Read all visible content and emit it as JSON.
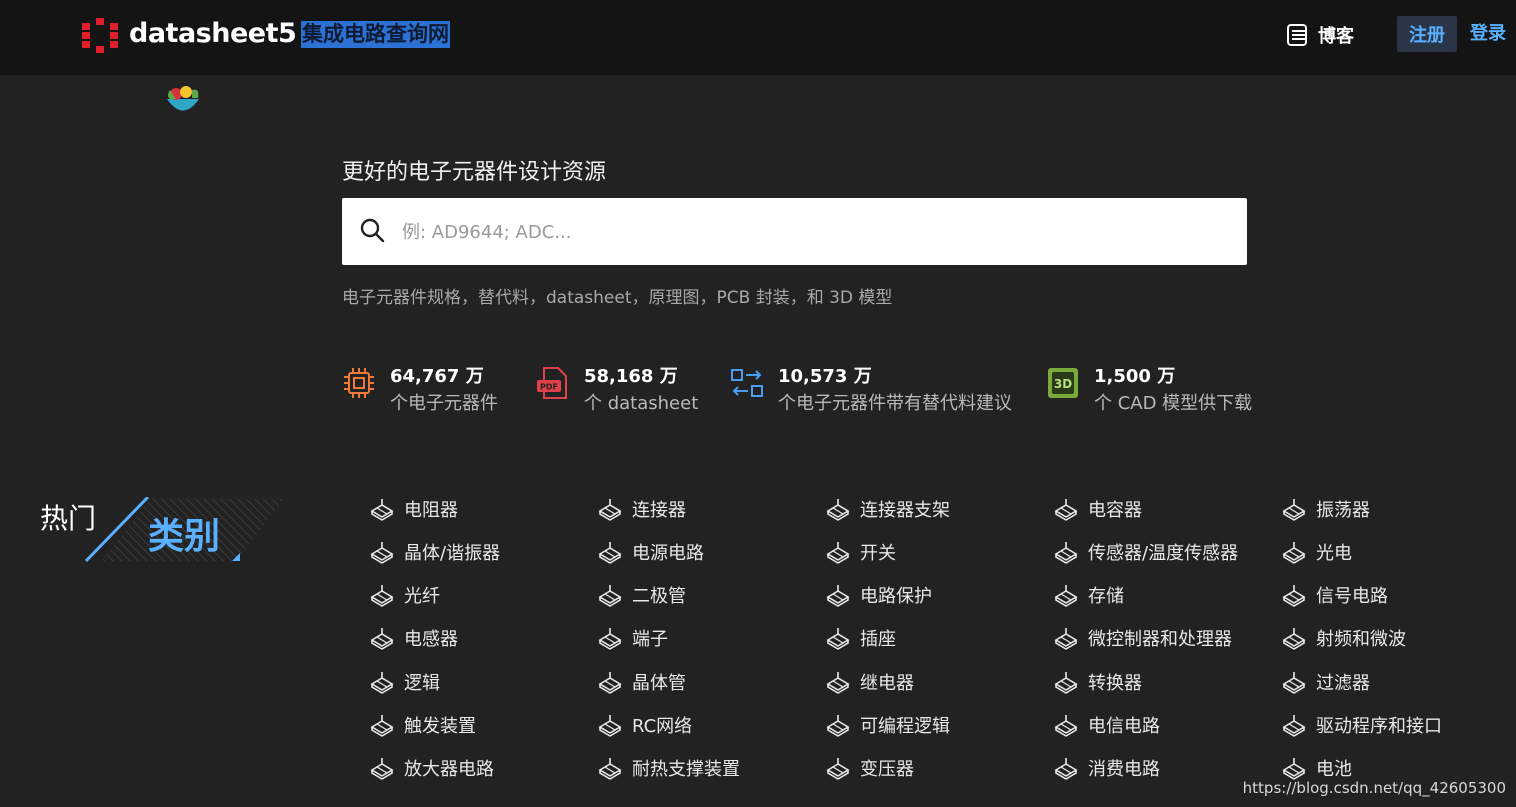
{
  "header": {
    "brand": "datasheet5",
    "brand_sub": "集成电路查询网",
    "blog": "博客",
    "register": "注册",
    "login": "登录"
  },
  "hero": {
    "tagline": "更好的电子元器件设计资源",
    "search_placeholder": "例: AD9644; ADC...",
    "subline": "电子元器件规格，替代料，datasheet，原理图，PCB 封装，和 3D 模型"
  },
  "stats": [
    {
      "icon": "chip-icon",
      "number": "64,767 万",
      "label": "个电子元器件",
      "color": "#f07a3a"
    },
    {
      "icon": "pdf-icon",
      "number": "58,168 万",
      "label": "个 datasheet",
      "color": "#e0404a"
    },
    {
      "icon": "swap-icon",
      "number": "10,573 万",
      "label": "个电子元器件带有替代料建议",
      "color": "#4a9ef0"
    },
    {
      "icon": "3d-model-icon",
      "number": "1,500 万",
      "label": "个 CAD 模型供下载",
      "color": "#7aaa3a"
    }
  ],
  "categories": {
    "heading_1": "热门",
    "heading_2": "类别",
    "columns": [
      [
        "电阻器",
        "晶体/谐振器",
        "光纤",
        "电感器",
        "逻辑",
        "触发装置",
        "放大器电路"
      ],
      [
        "连接器",
        "电源电路",
        "二极管",
        "端子",
        "晶体管",
        "RC网络",
        "耐热支撑装置"
      ],
      [
        "连接器支架",
        "开关",
        "电路保护",
        "插座",
        "继电器",
        "可编程逻辑",
        "变压器"
      ],
      [
        "电容器",
        "传感器/温度传感器",
        "存储",
        "微控制器和处理器",
        "转换器",
        "电信电路",
        "消费电路"
      ],
      [
        "振荡器",
        "光电",
        "信号电路",
        "射频和微波",
        "过滤器",
        "驱动程序和接口",
        "电池"
      ]
    ]
  },
  "watermark": "https://blog.csdn.net/qq_42605300"
}
